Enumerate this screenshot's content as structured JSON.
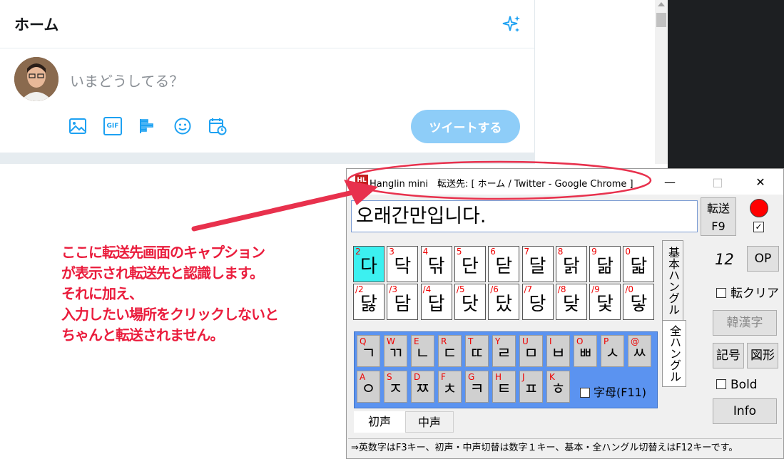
{
  "twitter": {
    "title": "ホーム",
    "placeholder": "いまどうしてる？",
    "tweet_button": "ツイートする",
    "gif_label": "GIF",
    "accent": "#1da1f2"
  },
  "annotation": {
    "lines": [
      "ここに転送先画面のキャプション",
      "が表示され転送先と認識します。",
      "それに加え、",
      "入力したい場所をクリックしないと",
      "ちゃんと転送されません。"
    ],
    "color": "#ea1c3c"
  },
  "window": {
    "app_icon": "HL",
    "title": "Hanglin mini　転送先: [ ホーム / Twitter - Google Chrome ]",
    "minimize": "—",
    "maximize": "□",
    "close": "✕"
  },
  "input_text": "오래간만입니다.",
  "send_button": [
    "転送",
    "F9"
  ],
  "check_mark": "✓",
  "grid": [
    [
      {
        "k": "2",
        "c": "다"
      },
      {
        "k": "3",
        "c": "닥"
      },
      {
        "k": "4",
        "c": "닦"
      },
      {
        "k": "5",
        "c": "단"
      },
      {
        "k": "6",
        "c": "닫"
      },
      {
        "k": "7",
        "c": "달"
      },
      {
        "k": "8",
        "c": "닭"
      },
      {
        "k": "9",
        "c": "닮"
      },
      {
        "k": "0",
        "c": "닯"
      }
    ],
    [
      {
        "k": "/2",
        "c": "닳"
      },
      {
        "k": "/3",
        "c": "담"
      },
      {
        "k": "/4",
        "c": "답"
      },
      {
        "k": "/5",
        "c": "닷"
      },
      {
        "k": "/6",
        "c": "닸"
      },
      {
        "k": "/7",
        "c": "당"
      },
      {
        "k": "/8",
        "c": "닺"
      },
      {
        "k": "/9",
        "c": "닻"
      },
      {
        "k": "/0",
        "c": "닿"
      }
    ]
  ],
  "tabs_vertical": [
    "基本ハングル",
    "全ハングル"
  ],
  "keyboard": {
    "row1": [
      {
        "k": "Q",
        "c": "ㄱ"
      },
      {
        "k": "W",
        "c": "ㄲ"
      },
      {
        "k": "E",
        "c": "ㄴ"
      },
      {
        "k": "R",
        "c": "ㄷ"
      },
      {
        "k": "T",
        "c": "ㄸ"
      },
      {
        "k": "Y",
        "c": "ㄹ"
      },
      {
        "k": "U",
        "c": "ㅁ"
      },
      {
        "k": "I",
        "c": "ㅂ"
      },
      {
        "k": "O",
        "c": "ㅃ"
      },
      {
        "k": "P",
        "c": "ㅅ"
      },
      {
        "k": "@",
        "c": "ㅆ"
      }
    ],
    "row2": [
      {
        "k": "A",
        "c": "ㅇ"
      },
      {
        "k": "S",
        "c": "ㅈ"
      },
      {
        "k": "D",
        "c": "ㅉ"
      },
      {
        "k": "F",
        "c": "ㅊ"
      },
      {
        "k": "G",
        "c": "ㅋ"
      },
      {
        "k": "H",
        "c": "ㅌ"
      },
      {
        "k": "J",
        "c": "ㅍ"
      },
      {
        "k": "K",
        "c": "ㅎ"
      }
    ],
    "jamo_label": "字母(F11)"
  },
  "bottom_tabs": [
    "初声",
    "中声"
  ],
  "right": {
    "size": "12",
    "op": "OP",
    "clear": "転クリア",
    "kanji": "韓漢字",
    "symbol": "記号",
    "shape": "図形",
    "bold": "Bold",
    "info": "Info"
  },
  "status": "⇒英数字はF3キー、初声・中声切替は数字１キー、基本・全ハングル切替えはF12キーです。"
}
